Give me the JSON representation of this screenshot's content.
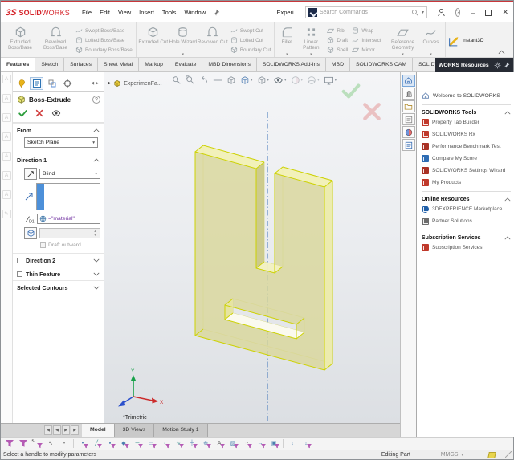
{
  "icons": {
    "caret_down": "▾",
    "flyout_arrow": "▶",
    "scroll_left": "◀",
    "scroll_right": "▶",
    "minimize": "–",
    "close": "✕",
    "select_cursor": "↖",
    "help": "?",
    "d1_label": "D1",
    "logo_mark": "3S",
    "spin_up": "▲",
    "spin_down": "▼"
  },
  "titlebar": {
    "logo_bold": "SOLID",
    "logo_light": "WORKS",
    "menus": [
      "File",
      "Edit",
      "View",
      "Insert",
      "Tools",
      "Window"
    ],
    "document_title": "Experi...",
    "search_placeholder": "Search Commands"
  },
  "ribbon": {
    "extruded_boss": "Extruded Boss/Base",
    "revolved_boss": "Revolved Boss/Base",
    "swept_boss": "Swept Boss/Base",
    "lofted_boss": "Lofted Boss/Base",
    "boundary_boss": "Boundary Boss/Base",
    "extruded_cut": "Extruded Cut",
    "hole_wizard": "Hole Wizard",
    "revolved_cut": "Revolved Cut",
    "swept_cut": "Swept Cut",
    "lofted_cut": "Lofted Cut",
    "boundary_cut": "Boundary Cut",
    "fillet": "Fillet",
    "linear_pattern": "Linear Pattern",
    "rib": "Rib",
    "draft": "Draft",
    "shell": "Shell",
    "wrap": "Wrap",
    "intersect": "Intersect",
    "mirror": "Mirror",
    "reference_geometry": "Reference Geometry",
    "curves": "Curves",
    "instant3d": "Instant3D"
  },
  "tabs": [
    "Features",
    "Sketch",
    "Surfaces",
    "Sheet Metal",
    "Markup",
    "Evaluate",
    "MBD Dimensions",
    "SOLIDWORKS Add-Ins",
    "MBD",
    "SOLIDWORKS CAM",
    "SOLIDWORKS CAM TBM"
  ],
  "taskpane": {
    "header": "WORKS Resources",
    "welcome": "Welcome to SOLIDWORKS",
    "tools_title": "SOLIDWORKS Tools",
    "tools_items": [
      "Property Tab Builder",
      "SOLIDWORKS Rx",
      "Performance Benchmark Test",
      "Compare My Score",
      "SOLIDWORKS Settings Wizard",
      "My Products"
    ],
    "online_title": "Online Resources",
    "online_items": [
      "3DEXPERIENCE Marketplace",
      "Partner Solutions"
    ],
    "subscription_title": "Subscription Services",
    "subscription_items": [
      "Subscription Services"
    ]
  },
  "property_manager": {
    "title": "Boss-Extrude",
    "from_label": "From",
    "from_value": "Sketch Plane",
    "direction1_label": "Direction 1",
    "end_condition": "Blind",
    "depth_value": "=\"material\"",
    "draft_outward_label": "Draft outward",
    "direction2_label": "Direction 2",
    "thin_feature_label": "Thin Feature",
    "selected_contours_label": "Selected Contours"
  },
  "viewport": {
    "feature_tree_item": "ExperimenFa...",
    "orientation": "*Trimetric",
    "axis_x": "X",
    "axis_y": "Y"
  },
  "model_tabs": [
    "Model",
    "3D Views",
    "Motion Study 1"
  ],
  "filter_glyphs": [
    "•",
    "╱",
    "▪",
    "◆",
    "─",
    "▭",
    "∙",
    "∿",
    "┼",
    "⊕",
    "A",
    "▨",
    "◔",
    "→",
    "▣",
    "↕"
  ],
  "statusbar": {
    "message": "Select a handle to modify parameters",
    "mode": "Editing Part",
    "units": "MMGS"
  },
  "colors": {
    "accent_red": "#d6262c",
    "model_fill": "#dbd99c",
    "model_edge": "#d4d800",
    "centerline": "#3f74b8",
    "taskpane_header_bg": "#272b34",
    "filter_purple": "#b45bb4"
  }
}
